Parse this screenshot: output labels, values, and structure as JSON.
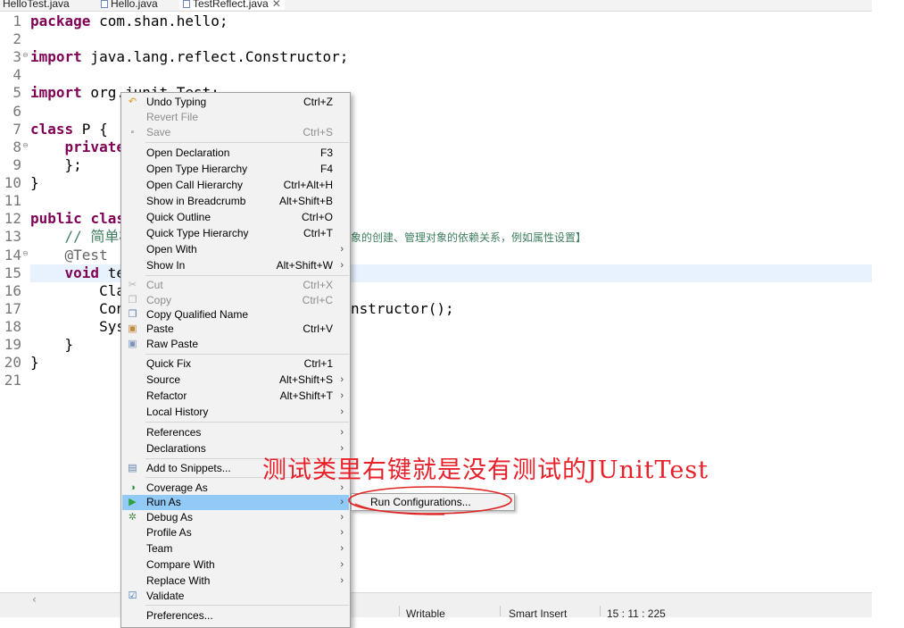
{
  "tabs": [
    {
      "label": "HelloTest.java",
      "active": false
    },
    {
      "label": "Hello.java",
      "active": false
    },
    {
      "label": "TestReflect.java",
      "active": true,
      "close": "✕"
    }
  ],
  "editor": {
    "lines": [
      {
        "n": "1",
        "fold": ""
      },
      {
        "n": "2",
        "fold": ""
      },
      {
        "n": "3",
        "fold": "⊖"
      },
      {
        "n": "4",
        "fold": ""
      },
      {
        "n": "5",
        "fold": ""
      },
      {
        "n": "6",
        "fold": ""
      },
      {
        "n": "7",
        "fold": ""
      },
      {
        "n": "8",
        "fold": "⊖"
      },
      {
        "n": "9",
        "fold": ""
      },
      {
        "n": "10",
        "fold": ""
      },
      {
        "n": "11",
        "fold": ""
      },
      {
        "n": "12",
        "fold": ""
      },
      {
        "n": "13",
        "fold": ""
      },
      {
        "n": "14",
        "fold": "⊖"
      },
      {
        "n": "15",
        "fold": ""
      },
      {
        "n": "16",
        "fold": ""
      },
      {
        "n": "17",
        "fold": ""
      },
      {
        "n": "18",
        "fold": ""
      },
      {
        "n": "19",
        "fold": ""
      },
      {
        "n": "20",
        "fold": ""
      },
      {
        "n": "21",
        "fold": ""
      }
    ],
    "code": {
      "l1_kw": "package",
      "l1_rest": " com.shan.hello;",
      "l3_kw": "import",
      "l3_rest": " java.lang.reflect.Constructor;",
      "l5_kw": "import",
      "l5_rest": " org.junit.Test;",
      "l7_kw": "class",
      "l7_rest": " P {",
      "l8_indent": "    ",
      "l8_kw": "private",
      "l9": "    };",
      "l10": "}",
      "l12_kw1": "public",
      "l12_kw2": "class",
      "l13_comment": "    // 简单模",
      "l13_comment_tail": "象的创建、管理对象的依赖关系，例如属性设置】",
      "l14_annot": "    @Test",
      "l15_indent": "    ",
      "l15_kw": "void",
      "l15_rest": " te",
      "l16": "        Cla",
      "l17": "        Con",
      "l17_tail": "nstructor();",
      "l18": "        Sys",
      "l19": "    }",
      "l20": "}"
    }
  },
  "context_menu": {
    "items": [
      {
        "label": "Undo Typing",
        "accel": "Ctrl+Z",
        "icon": "undo-icon",
        "glyph": "↶",
        "color": "#d89a21"
      },
      {
        "label": "Revert File",
        "disabled": true
      },
      {
        "label": "Save",
        "accel": "Ctrl+S",
        "disabled": true,
        "icon": "save-icon",
        "glyph": "▪",
        "color": "#b0b0b0"
      },
      {
        "label": "Open Declaration",
        "accel": "F3"
      },
      {
        "label": "Open Type Hierarchy",
        "accel": "F4"
      },
      {
        "label": "Open Call Hierarchy",
        "accel": "Ctrl+Alt+H"
      },
      {
        "label": "Show in Breadcrumb",
        "accel": "Alt+Shift+B"
      },
      {
        "label": "Quick Outline",
        "accel": "Ctrl+O"
      },
      {
        "label": "Quick Type Hierarchy",
        "accel": "Ctrl+T"
      },
      {
        "label": "Open With",
        "submenu": true
      },
      {
        "label": "Show In",
        "accel": "Alt+Shift+W",
        "submenu": true
      },
      {
        "label": "Cut",
        "accel": "Ctrl+X",
        "disabled": true,
        "icon": "cut-icon",
        "glyph": "✂",
        "color": "#b0b0b0"
      },
      {
        "label": "Copy",
        "accel": "Ctrl+C",
        "disabled": true,
        "icon": "copy-icon",
        "glyph": "❐",
        "color": "#b0b0b0"
      },
      {
        "label": "Copy Qualified Name",
        "icon": "copy-qualified-name-icon",
        "glyph": "❐",
        "color": "#5577aa"
      },
      {
        "label": "Paste",
        "accel": "Ctrl+V",
        "icon": "paste-icon",
        "glyph": "▣",
        "color": "#c08a3e"
      },
      {
        "label": "Raw Paste",
        "icon": "raw-paste-icon",
        "glyph": "▣",
        "color": "#7d95b8"
      },
      {
        "label": "Quick Fix",
        "accel": "Ctrl+1"
      },
      {
        "label": "Source",
        "accel": "Alt+Shift+S",
        "submenu": true
      },
      {
        "label": "Refactor",
        "accel": "Alt+Shift+T",
        "submenu": true
      },
      {
        "label": "Local History",
        "submenu": true
      },
      {
        "label": "References",
        "submenu": true
      },
      {
        "label": "Declarations",
        "submenu": true
      },
      {
        "label": "Add to Snippets...",
        "icon": "snippets-icon",
        "glyph": "▤",
        "color": "#5f7fa8"
      },
      {
        "label": "Coverage As",
        "submenu": true,
        "icon": "coverage-icon",
        "glyph": "◑",
        "color": "#2d8f3a"
      },
      {
        "label": "Run As",
        "submenu": true,
        "highlighted": true,
        "icon": "run-icon",
        "glyph": "▶",
        "color": "#2f9e3e"
      },
      {
        "label": "Debug As",
        "submenu": true,
        "icon": "debug-icon",
        "glyph": "✲",
        "color": "#4d8a4d"
      },
      {
        "label": "Profile As",
        "submenu": true
      },
      {
        "label": "Team",
        "submenu": true
      },
      {
        "label": "Compare With",
        "submenu": true
      },
      {
        "label": "Replace With",
        "submenu": true
      },
      {
        "label": "Validate",
        "icon": "validate-check-icon",
        "glyph": "☑",
        "color": "#3a6fb0"
      },
      {
        "label": "Preferences..."
      }
    ],
    "arrow_glyph": "›"
  },
  "submenu": {
    "label": "Run Configurations..."
  },
  "annotation": {
    "text": "测试类里右键就是没有测试的JUnitTest",
    "color": "#e8202a"
  },
  "status_bar": {
    "scroll_left": "‹",
    "writable": "Writable",
    "insert_mode": "Smart Insert",
    "position": "15 : 11 : 225"
  },
  "colors": {
    "keyword": "#7f0055",
    "comment": "#3f7f5f",
    "annotation": "#646464",
    "current_line": "#e8f2fe",
    "menu_highlight": "#91c9f7"
  }
}
